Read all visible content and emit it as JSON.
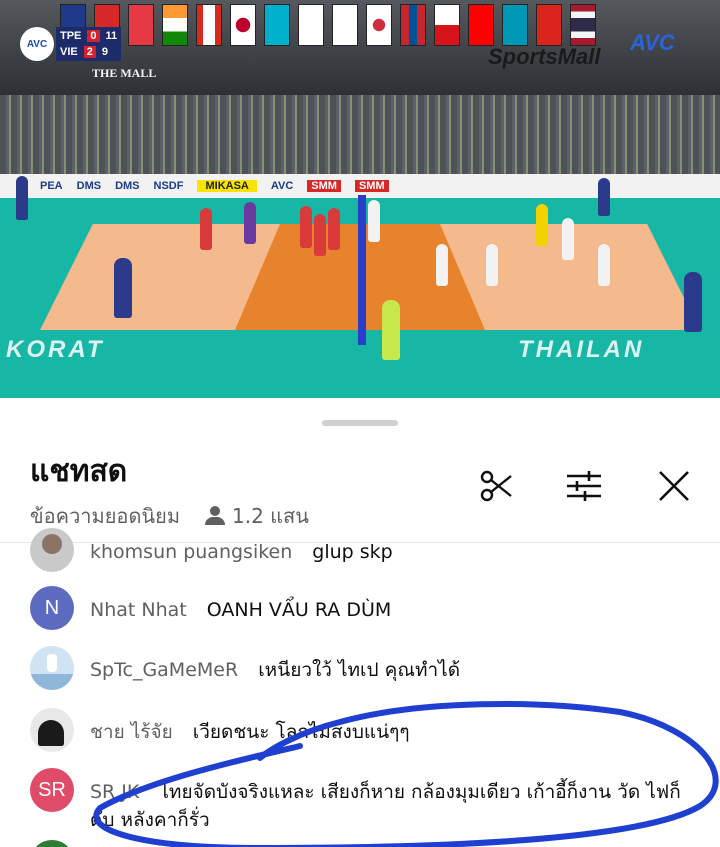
{
  "video": {
    "score": {
      "team1": "TPE",
      "team1_sets": "0",
      "team1_points": "11",
      "team2": "VIE",
      "team2_sets": "2",
      "team2_points": "9",
      "logo": "AVC"
    },
    "venue_sponsor": "THE MALL",
    "broadcaster": "SportsMall",
    "broadcaster_mark": "AVC",
    "floor_text_left": "KORAT",
    "floor_text_right": "THAILAN",
    "ad_boards": [
      "PEA",
      "DMS",
      "DMS",
      "NSDF",
      "MIKASA",
      "AVC",
      "SMM",
      "SMM"
    ],
    "colors": {
      "court_inner": "#e8832d",
      "court_outer": "#f4b98d",
      "floor": "#18b6a4"
    }
  },
  "chat": {
    "title": "แชทสด",
    "filter_label": "ข้อความยอดนิยม",
    "viewer_count": "1.2 แสน",
    "icons": {
      "viewers": "person-icon",
      "clip": "scissors-icon",
      "settings": "sliders-icon",
      "close": "close-icon"
    },
    "messages": [
      {
        "author": "khomsun puangsiken",
        "text": "glup skp",
        "avatar_letter": "",
        "avatar_color": "#c9c9c9"
      },
      {
        "author": "Nhat Nhat",
        "text": "OANH VẨU RA DÙM",
        "avatar_letter": "N",
        "avatar_color": "#5c6bc0"
      },
      {
        "author": "SpTc_GaMeMeR",
        "text": "เหนียวใว้ ไทเป คุณทำได้",
        "avatar_letter": "",
        "avatar_color": "#8fb7d9"
      },
      {
        "author": "ชาย ไร้จัย",
        "text": "เวียดชนะ โลกไม่สงบแน่ๆๆ",
        "avatar_letter": "",
        "avatar_color": "#1a1a1a"
      },
      {
        "author": "SR JK",
        "text": "ไทยจัดบังจริงแหละ เสียงก็หาย กล้องมุมเดียว เก้าอี้ก็งาน วัด ไฟก็ดับ หลังคาก็รั่ว",
        "avatar_letter": "SR",
        "avatar_color": "#e04b6a"
      }
    ],
    "highlight_color": "#1f3fd1"
  }
}
